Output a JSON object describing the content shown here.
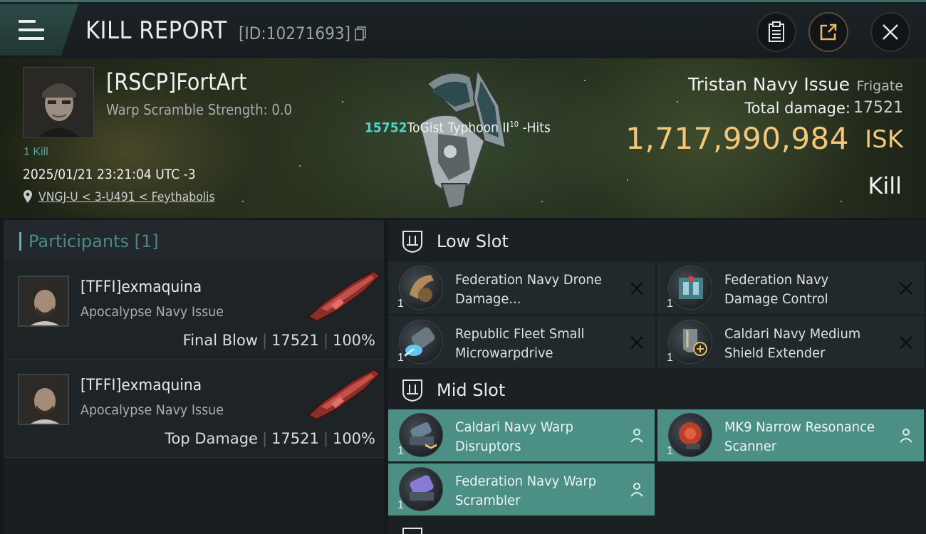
{
  "header": {
    "title": "KILL REPORT",
    "report_id": "[ID:10271693]"
  },
  "victim": {
    "pilot_name": "[RSCP]FortArt",
    "warp_scramble": "Warp Scramble Strength: 0.0",
    "kill_count": "1 Kill",
    "datetime": "2025/01/21 23:21:04 UTC -3",
    "location": "VNGJ-U < 3-U491 < Feythabolis",
    "ship_name": "Tristan Navy Issue",
    "ship_class": "Frigate",
    "damage_label": "Total damage:",
    "damage_value": "17521",
    "isk_value": "1,717,990,984",
    "isk_label": "ISK",
    "status": "Kill"
  },
  "hit_info": {
    "count": "15752",
    "text": "ToGist Typhoon II",
    "level": "10",
    "suffix": " -Hits"
  },
  "participants": {
    "title": "Participants [1]",
    "items": [
      {
        "name": "[TFFI]exmaquina",
        "ship": "Apocalypse Navy Issue",
        "role": "Final Blow",
        "damage": "17521",
        "percent": "100%"
      },
      {
        "name": "[TFFI]exmaquina",
        "ship": "Apocalypse Navy Issue",
        "role": "Top Damage",
        "damage": "17521",
        "percent": "100%"
      }
    ]
  },
  "fitting": {
    "low_slot": {
      "title": "Low Slot",
      "modules": [
        {
          "qty": "1",
          "name": "Federation Navy Drone Damage...",
          "icon": "drone-damage-icon",
          "status": "destroyed"
        },
        {
          "qty": "1",
          "name": "Federation Navy Damage Control",
          "icon": "damage-control-icon",
          "status": "destroyed"
        },
        {
          "qty": "1",
          "name": "Republic Fleet Small Microwarpdrive",
          "icon": "microwarpdrive-icon",
          "status": "destroyed"
        },
        {
          "qty": "1",
          "name": "Caldari Navy Medium Shield Extender",
          "icon": "shield-extender-icon",
          "status": "destroyed"
        }
      ]
    },
    "mid_slot": {
      "title": "Mid Slot",
      "modules": [
        {
          "qty": "1",
          "name": "Caldari Navy Warp Disruptors",
          "icon": "warp-disruptor-icon",
          "status": "dropped"
        },
        {
          "qty": "1",
          "name": "MK9 Narrow Resonance Scanner",
          "icon": "scanner-icon",
          "status": "dropped"
        },
        {
          "qty": "1",
          "name": "Federation Navy Warp Scrambler",
          "icon": "warp-scrambler-icon",
          "status": "dropped"
        }
      ]
    }
  },
  "colors": {
    "accent_teal": "#4b8f85",
    "isk_gold": "#f3c77a",
    "hit_cyan": "#46d7d0"
  }
}
